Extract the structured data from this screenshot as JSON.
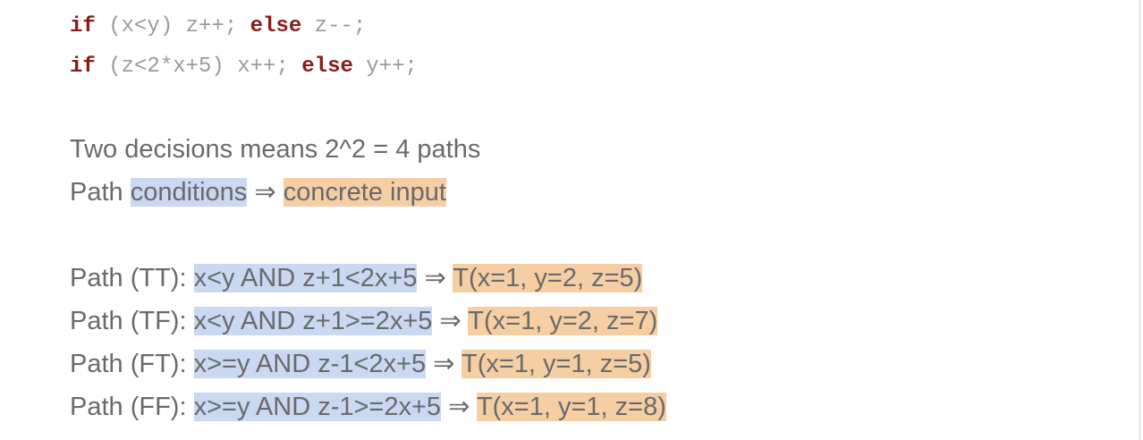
{
  "code_lines": [
    {
      "kw1": "if",
      "cond": " (x<y) ",
      "stmt1": "z++; ",
      "kw2": "else",
      "stmt2": " z--;"
    },
    {
      "kw1": "if",
      "cond": " (z<2*x+5) ",
      "stmt1": "x++; ",
      "kw2": "else",
      "stmt2": " y++;"
    }
  ],
  "summary": {
    "decisions_text": "Two decisions means 2^2 = 4 paths",
    "path_prefix": "Path ",
    "conditions_label": "conditions",
    "arrow": " ⇒ ",
    "concrete_label": "concrete input"
  },
  "paths": [
    {
      "label": "Path (TT): ",
      "condition": "x<y AND z+1<2x+5",
      "arrow": " ⇒ ",
      "input": "T(x=1, y=2, z=5)"
    },
    {
      "label": "Path (TF): ",
      "condition": "x<y AND z+1>=2x+5",
      "arrow": " ⇒ ",
      "input": "T(x=1, y=2, z=7)"
    },
    {
      "label": "Path (FT): ",
      "condition": "x>=y AND z-1<2x+5",
      "arrow": " ⇒ ",
      "input": "T(x=1, y=1, z=5)"
    },
    {
      "label": "Path (FF): ",
      "condition": "x>=y AND z-1>=2x+5",
      "arrow": " ⇒ ",
      "input": "T(x=1, y=1, z=8)"
    }
  ],
  "colors": {
    "keyword": "#8b1a1a",
    "code_text": "#9a9a9a",
    "body_text": "#6a6a6a",
    "condition_highlight": "#cad8f2",
    "input_highlight": "#f5cea4"
  }
}
